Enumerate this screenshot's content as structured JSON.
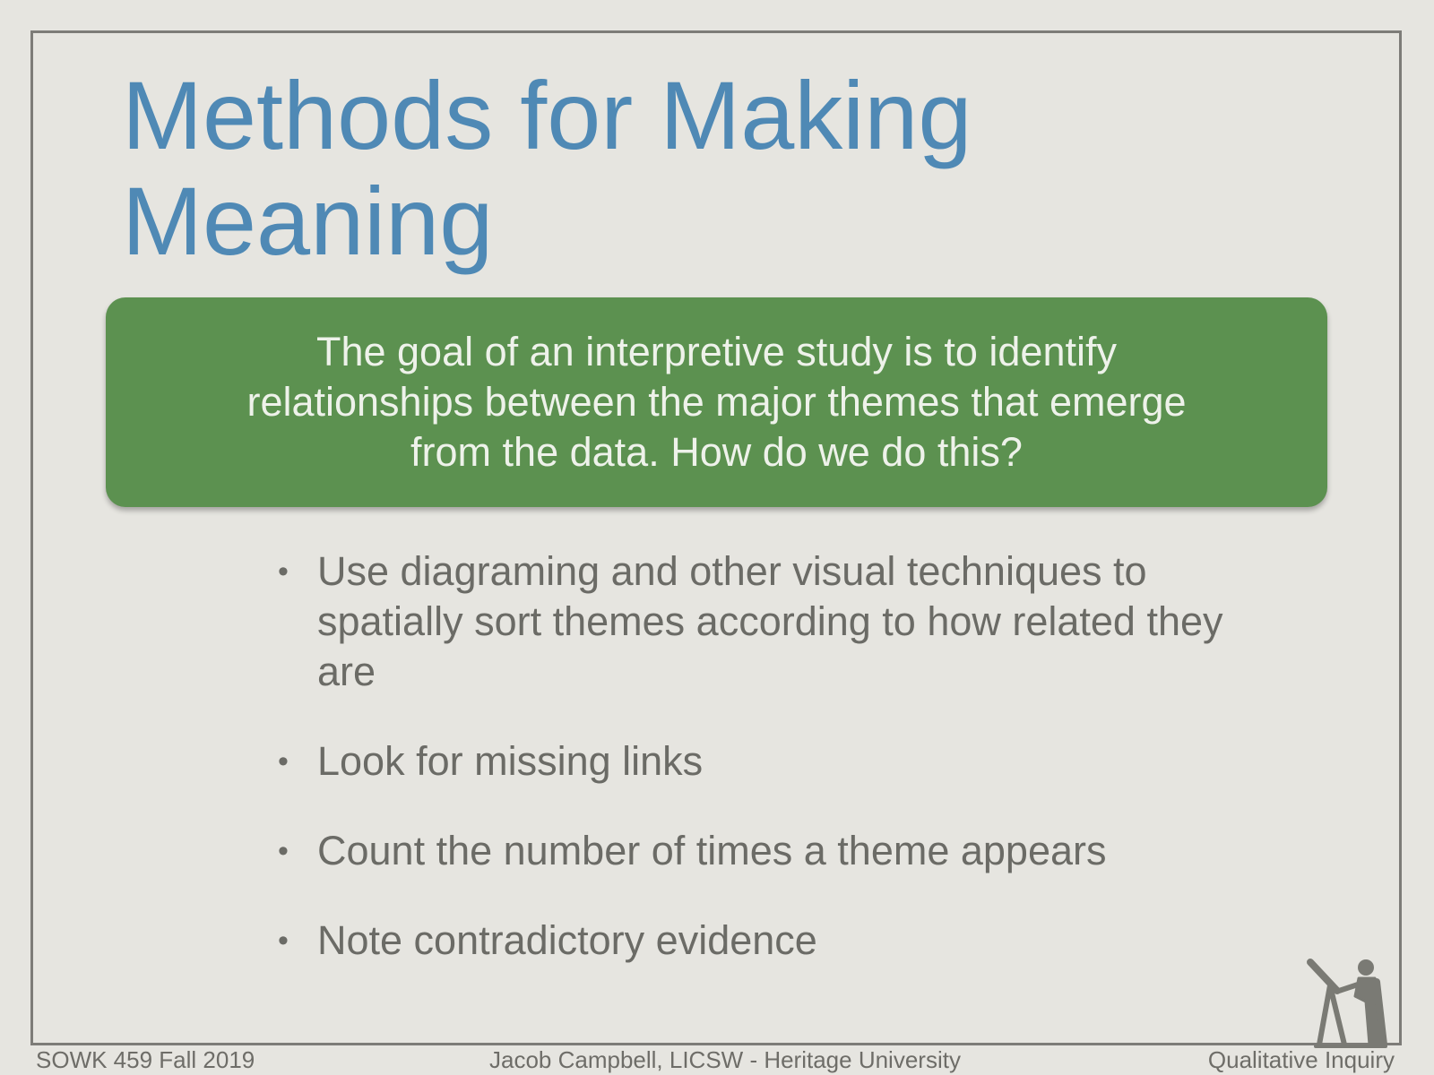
{
  "slide": {
    "title_line1": "Methods for Making",
    "title_line2": "Meaning",
    "callout": "The goal of an interpretive study is to identify\nrelationships between the major themes that emerge\nfrom the data.  How do we do this?",
    "bullets": [
      "Use diagraming  and other visual techniques to spatially sort themes according to how related they are",
      "Look for missing links",
      "Count the number of times a theme appears",
      "Note contradictory evidence"
    ],
    "bullet_glyph": "•"
  },
  "footer": {
    "left": "SOWK 459 Fall 2019",
    "center": "Jacob Campbell, LICSW - Heritage University",
    "right": "Qualitative Inquiry"
  },
  "colors": {
    "background": "#e6e5e0",
    "title": "#4f89b5",
    "callout_bg": "#5c9150",
    "body_text": "#6b6b66"
  },
  "icons": {
    "mascot": "person-telescope-icon"
  }
}
